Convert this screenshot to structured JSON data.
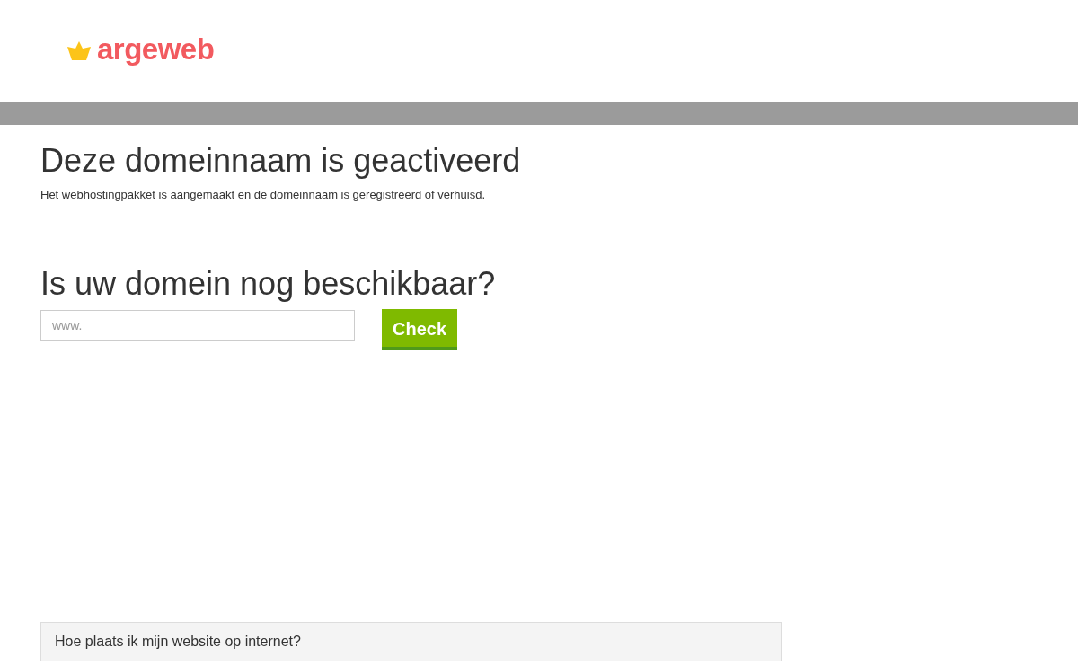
{
  "logo": {
    "text": "argeweb"
  },
  "activated": {
    "title": "Deze domeinnaam is geactiveerd",
    "text": "Het webhostingpakket is aangemaakt en de domeinnaam is geregistreerd of verhuisd."
  },
  "domain_check": {
    "title": "Is uw domein nog beschikbaar?",
    "placeholder": "www.",
    "button": "Check"
  },
  "faq": [
    {
      "question": "Hoe plaats ik mijn website op internet?"
    }
  ]
}
